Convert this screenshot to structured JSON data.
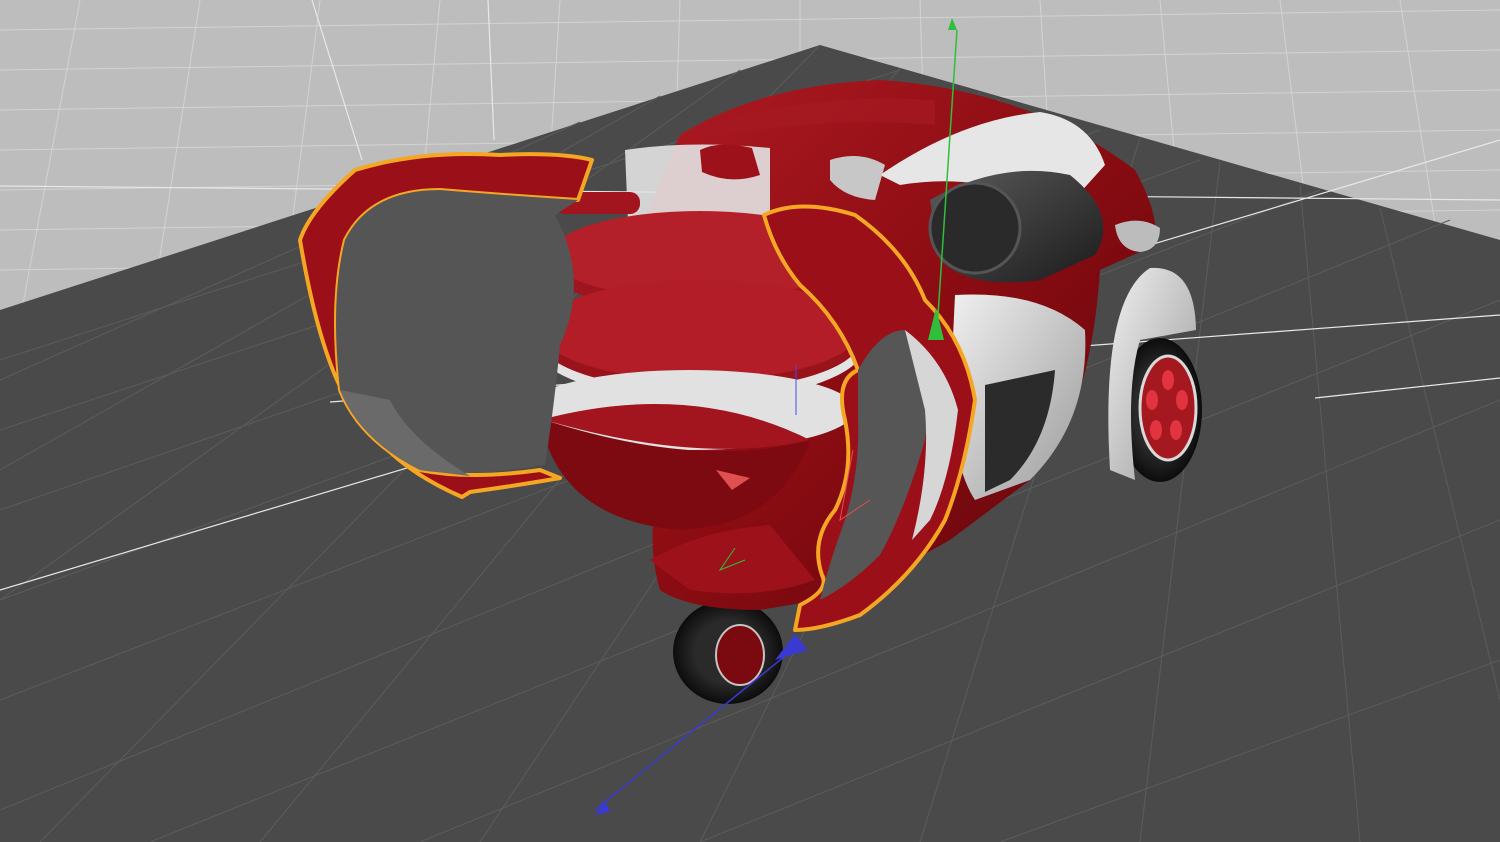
{
  "viewport": {
    "label": "",
    "selection": "door-panels",
    "active_tool": "move"
  },
  "model": {
    "name": "",
    "body_color": "#8c0d14",
    "trim_color": "#d8d8d8",
    "selection_outline_color": "#f5a623"
  },
  "grid": {
    "background_color": "#bdbdbd",
    "floor_color": "#4a4a4a",
    "line_color_light": "#d6d6d6",
    "line_color_dark": "#5a5a5a"
  },
  "gizmo": {
    "x_axis_color": "#e05050",
    "y_axis_color": "#2fbf3a",
    "z_axis_color": "#3a3ad0"
  },
  "icons": {
    "gizmo_y": "arrow-up-icon",
    "gizmo_z": "arrow-icon",
    "gizmo_x": "arrow-icon"
  }
}
